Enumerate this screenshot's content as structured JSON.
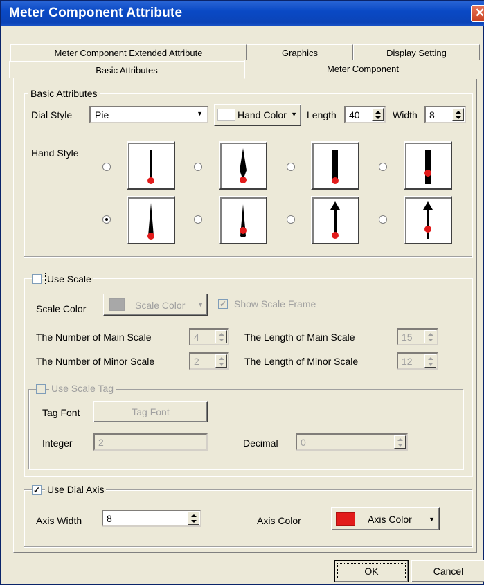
{
  "window": {
    "title": "Meter Component Attribute",
    "close_glyph": "✕"
  },
  "tabs": {
    "row1": [
      "Meter Component Extended Attribute",
      "Graphics",
      "Display Setting"
    ],
    "row2": [
      "Basic Attributes",
      "Meter Component"
    ]
  },
  "basic": {
    "group_title": "Basic Attributes",
    "dial_style_label": "Dial Style",
    "dial_style_value": "Pie",
    "hand_color_label": "Hand Color",
    "length_label": "Length",
    "length_value": "40",
    "width_label": "Width",
    "width_value": "8",
    "hand_style_label": "Hand Style",
    "hand_styles_selected_index": 4
  },
  "scale": {
    "use_scale_label": "Use Scale",
    "use_scale_checked": false,
    "scale_color_label": "Scale Color",
    "scale_color_button": "Scale Color",
    "show_scale_frame_label": "Show Scale Frame",
    "show_scale_frame_check": "✓",
    "num_main_label": "The Number of Main Scale",
    "num_main_value": "4",
    "len_main_label": "The Length of Main Scale",
    "len_main_value": "15",
    "num_minor_label": "The Number of Minor Scale",
    "num_minor_value": "2",
    "len_minor_label": "The Length of Minor Scale",
    "len_minor_value": "12",
    "use_scale_tag_label": "Use Scale Tag",
    "tag_font_label": "Tag Font",
    "tag_font_button": "Tag Font",
    "integer_label": "Integer",
    "integer_value": "2",
    "decimal_label": "Decimal",
    "decimal_value": "0"
  },
  "axis": {
    "use_dial_axis_label": "Use Dial Axis",
    "use_dial_axis_check": "✓",
    "axis_width_label": "Axis Width",
    "axis_width_value": "8",
    "axis_color_label": "Axis Color",
    "axis_color_button": "Axis Color",
    "axis_color": "#e21b1b"
  },
  "buttons": {
    "ok": "OK",
    "cancel": "Cancel"
  },
  "colors": {
    "titlebar": "#0a49c5",
    "dialog_bg": "#ece9d8",
    "hand_dot": "#e21b1b"
  }
}
